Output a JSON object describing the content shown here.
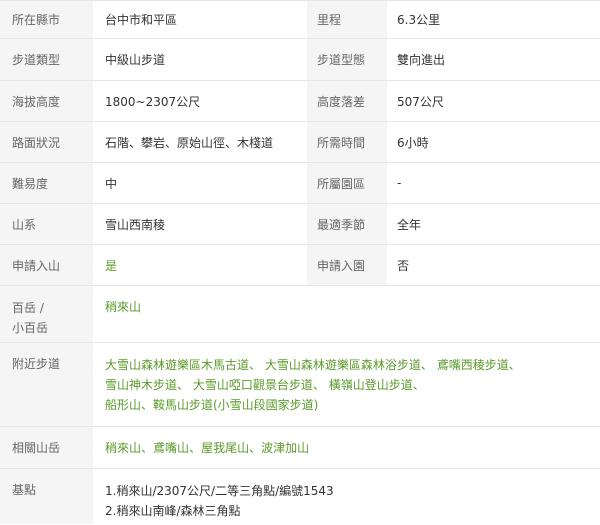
{
  "rows": [
    {
      "label": "所在縣市",
      "value": "台中市和平區",
      "label2": "里程",
      "value2": "6.3公里"
    },
    {
      "label": "步道類型",
      "value": "中級山步道",
      "label2": "步道型態",
      "value2": "雙向進出"
    },
    {
      "label": "海拔高度",
      "value": "1800~2307公尺",
      "label2": "高度落差",
      "value2": "507公尺"
    },
    {
      "label": "路面狀況",
      "value": "石階、攀岩、原始山徑、木棧道",
      "label2": "所需時間",
      "value2": "6小時"
    },
    {
      "label": "難易度",
      "value": "中",
      "label2": "所屬園區",
      "value2": "-"
    },
    {
      "label": "山系",
      "value": "雪山西南稜",
      "label2": "最適季節",
      "value2": "全年"
    },
    {
      "label": "申請入山",
      "value": "是",
      "label2": "申請入園",
      "value2": "否"
    }
  ],
  "baiyue": {
    "label_line1": "百岳 /",
    "label_line2": "小百岳",
    "value": "稍來山"
  },
  "nearby": {
    "label": "附近步道",
    "line1": [
      "大雪山森林遊樂區木馬古道",
      "大雪山森林遊樂區森林浴步道",
      "鳶嘴西稜步道"
    ],
    "line2": [
      "雪山神木步道",
      "大雪山啞口觀景台步道",
      "橫嶺山登山步道"
    ],
    "line3": [
      "船形山、鞍馬山步道(小雪山段國家步道)"
    ],
    "sep": "、"
  },
  "related": {
    "label": "相關山岳",
    "items": [
      "稍來山",
      "鳶嘴山",
      "屋我尾山",
      "波津加山"
    ],
    "sep": "、"
  },
  "benchmark": {
    "label": "基點",
    "line1": "1.稍來山/2307公尺/二等三角點/編號1543",
    "line2": "2.稍來山南峰/森林三角點"
  }
}
